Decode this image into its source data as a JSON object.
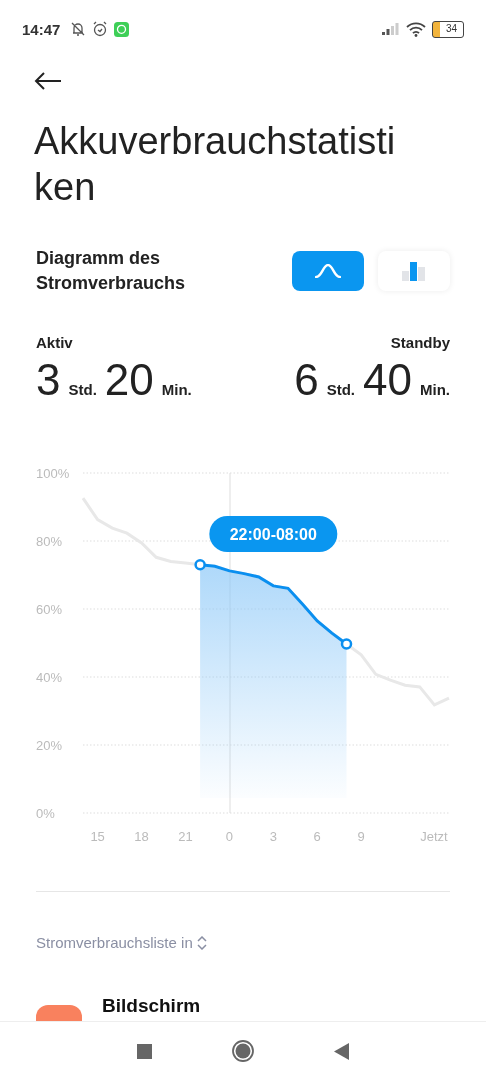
{
  "status_bar": {
    "time": "14:47",
    "battery": "34"
  },
  "title_lines": [
    "Akkuverbrauchstatisti",
    "ken"
  ],
  "section": {
    "title": "Diagramm des Stromverbrauchs",
    "chart_types": [
      {
        "kind": "line",
        "selected": true
      },
      {
        "kind": "bar",
        "selected": false
      }
    ]
  },
  "stats": [
    {
      "label": "Aktiv",
      "hours": "3",
      "hours_unit": "Std.",
      "minutes": "20",
      "minutes_unit": "Min."
    },
    {
      "label": "Standby",
      "hours": "6",
      "hours_unit": "Std.",
      "minutes": "40",
      "minutes_unit": "Min."
    }
  ],
  "selection_label": "22:00-08:00",
  "chart_data": {
    "type": "line",
    "grid": true,
    "ylim": [
      0,
      100
    ],
    "categories": [
      null,
      "15",
      null,
      null,
      "18",
      null,
      null,
      "21",
      null,
      null,
      "0",
      null,
      null,
      "3",
      null,
      null,
      "6",
      null,
      null,
      "9",
      null,
      null,
      null,
      null,
      "Jetzt",
      null
    ],
    "yticks": [
      {
        "value": 0,
        "label": "0%"
      },
      {
        "value": 20,
        "label": "20%"
      },
      {
        "value": 40,
        "label": "40%"
      },
      {
        "value": 60,
        "label": "60%"
      },
      {
        "value": 80,
        "label": "80%"
      },
      {
        "value": 100,
        "label": "100%"
      }
    ],
    "series": [
      {
        "color": "#e8e8e8",
        "values": [
          92.6,
          86.3,
          83.8,
          82.3,
          79.4,
          75.2,
          74,
          73.5,
          73,
          72.6,
          71.2,
          70.4,
          69.4,
          66.8,
          66.1,
          61.4,
          56.5,
          52.9,
          49.7,
          46.5,
          40.8,
          39.1,
          37.6,
          37.1,
          31.8,
          33.8
        ]
      },
      {
        "color": "#0a8ff0",
        "values": [
          null,
          null,
          null,
          null,
          null,
          null,
          null,
          null,
          73,
          72.6,
          71.2,
          70.4,
          69.4,
          66.8,
          66.1,
          61.4,
          56.5,
          52.9,
          49.7,
          null,
          null,
          null,
          null,
          null,
          null,
          null
        ]
      }
    ]
  },
  "list": {
    "header": "Stromverbrauchsliste in",
    "items": [
      {
        "title": "Bildschirm"
      }
    ]
  }
}
